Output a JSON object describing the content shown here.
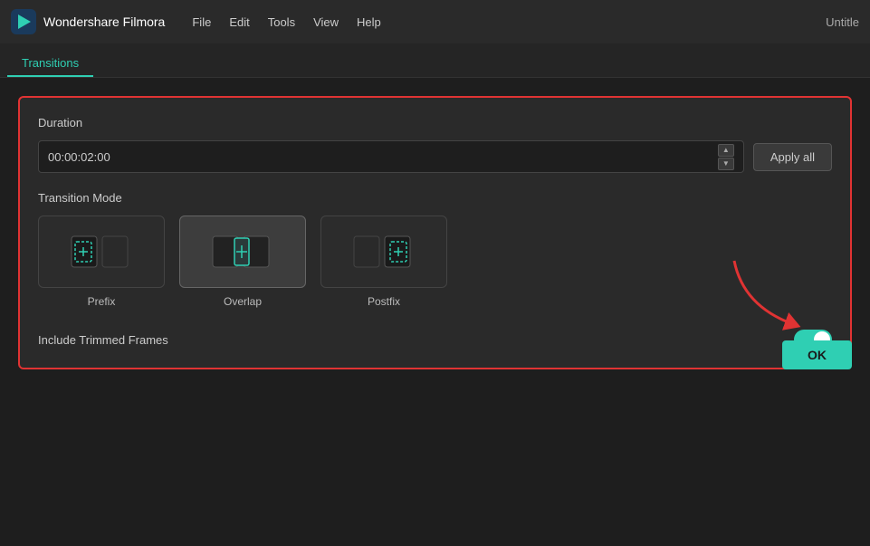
{
  "app": {
    "name": "Wondershare Filmora",
    "title_suffix": "Untitle"
  },
  "menu": {
    "items": [
      "File",
      "Edit",
      "Tools",
      "View",
      "Help"
    ]
  },
  "tabs": {
    "active": "Transitions",
    "list": [
      "Transitions"
    ]
  },
  "settings": {
    "duration_label": "Duration",
    "duration_value": "00:00:02:00",
    "apply_all_label": "Apply all",
    "transition_mode_label": "Transition Mode",
    "modes": [
      {
        "name": "prefix",
        "label": "Prefix",
        "selected": false
      },
      {
        "name": "overlap",
        "label": "Overlap",
        "selected": true
      },
      {
        "name": "postfix",
        "label": "Postfix",
        "selected": false
      }
    ],
    "include_trimmed_label": "Include Trimmed Frames",
    "include_trimmed_enabled": true
  },
  "footer": {
    "ok_label": "OK"
  }
}
